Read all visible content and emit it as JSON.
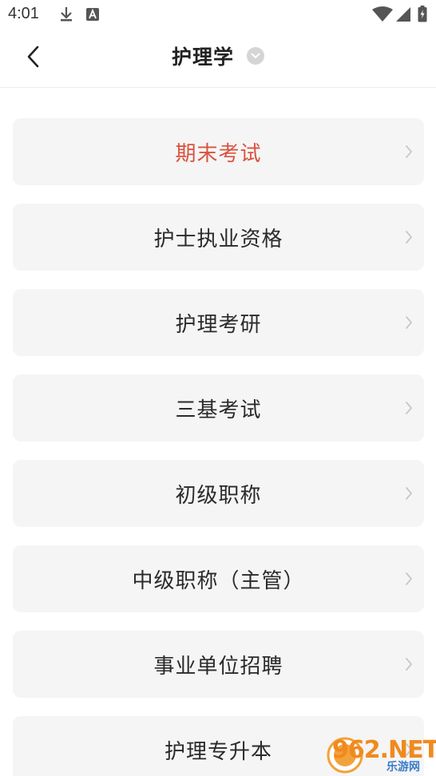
{
  "status_bar": {
    "time": "4:01",
    "icons": [
      "download-icon",
      "a-notification-icon",
      "wifi-icon",
      "signal-icon",
      "battery-icon"
    ]
  },
  "header": {
    "title": "护理学",
    "back_icon": "chevron-left-icon",
    "dropdown_icon": "chevron-down-icon"
  },
  "list": {
    "items": [
      {
        "label": "期末考试",
        "active": true
      },
      {
        "label": "护士执业资格",
        "active": false
      },
      {
        "label": "护理考研",
        "active": false
      },
      {
        "label": "三基考试",
        "active": false
      },
      {
        "label": "初级职称",
        "active": false
      },
      {
        "label": "中级职称（主管）",
        "active": false
      },
      {
        "label": "事业单位招聘",
        "active": false
      },
      {
        "label": "护理专升本",
        "active": false
      }
    ]
  },
  "colors": {
    "active_text": "#d9533f",
    "item_bg": "#f5f5f5",
    "chevron": "#c8c8c8"
  },
  "watermark": {
    "logo": "962.NET",
    "sub": "乐游网"
  }
}
